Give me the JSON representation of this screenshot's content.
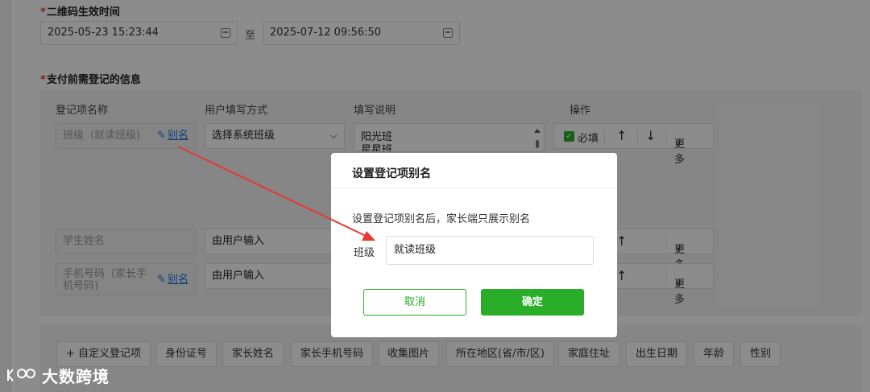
{
  "validity": {
    "label": "二维码生效时间",
    "start": "2025-05-23 15:23:44",
    "to": "至",
    "end": "2025-07-12 09:56:50"
  },
  "info": {
    "label": "支付前需登记的信息",
    "columns": [
      "登记项名称",
      "用户填写方式",
      "填写说明",
      "操作"
    ],
    "rows": [
      {
        "name": "班级（就读班级)",
        "alias": "别名",
        "method": "选择系统班级",
        "desc_line1": "阳光班",
        "desc_line2": "星星班",
        "required": "必填",
        "more": "更多"
      },
      {
        "name": "学生姓名",
        "method": "由用户输入",
        "more": "更多"
      },
      {
        "name_line1": "手机号码（家长手",
        "name_line2": "机号码)",
        "alias": "别名",
        "method": "由用户输入",
        "more": "更多"
      }
    ]
  },
  "tags": [
    "+ 自定义登记项",
    "身份证号",
    "家长姓名",
    "家长手机号码",
    "收集图片",
    "所在地区(省/市/区)",
    "家庭住址",
    "出生日期",
    "年龄",
    "性别"
  ],
  "modal": {
    "title": "设置登记项别名",
    "desc": "设置登记项别名后，家长端只展示别名",
    "field_label": "班级",
    "field_value": "就读班级",
    "cancel": "取消",
    "ok": "确定"
  },
  "watermark": "大数跨境",
  "colors": {
    "accent": "#2aae2a",
    "link": "#1a73e8",
    "required": "#e53935",
    "annotation_arrow": "#e53935"
  }
}
